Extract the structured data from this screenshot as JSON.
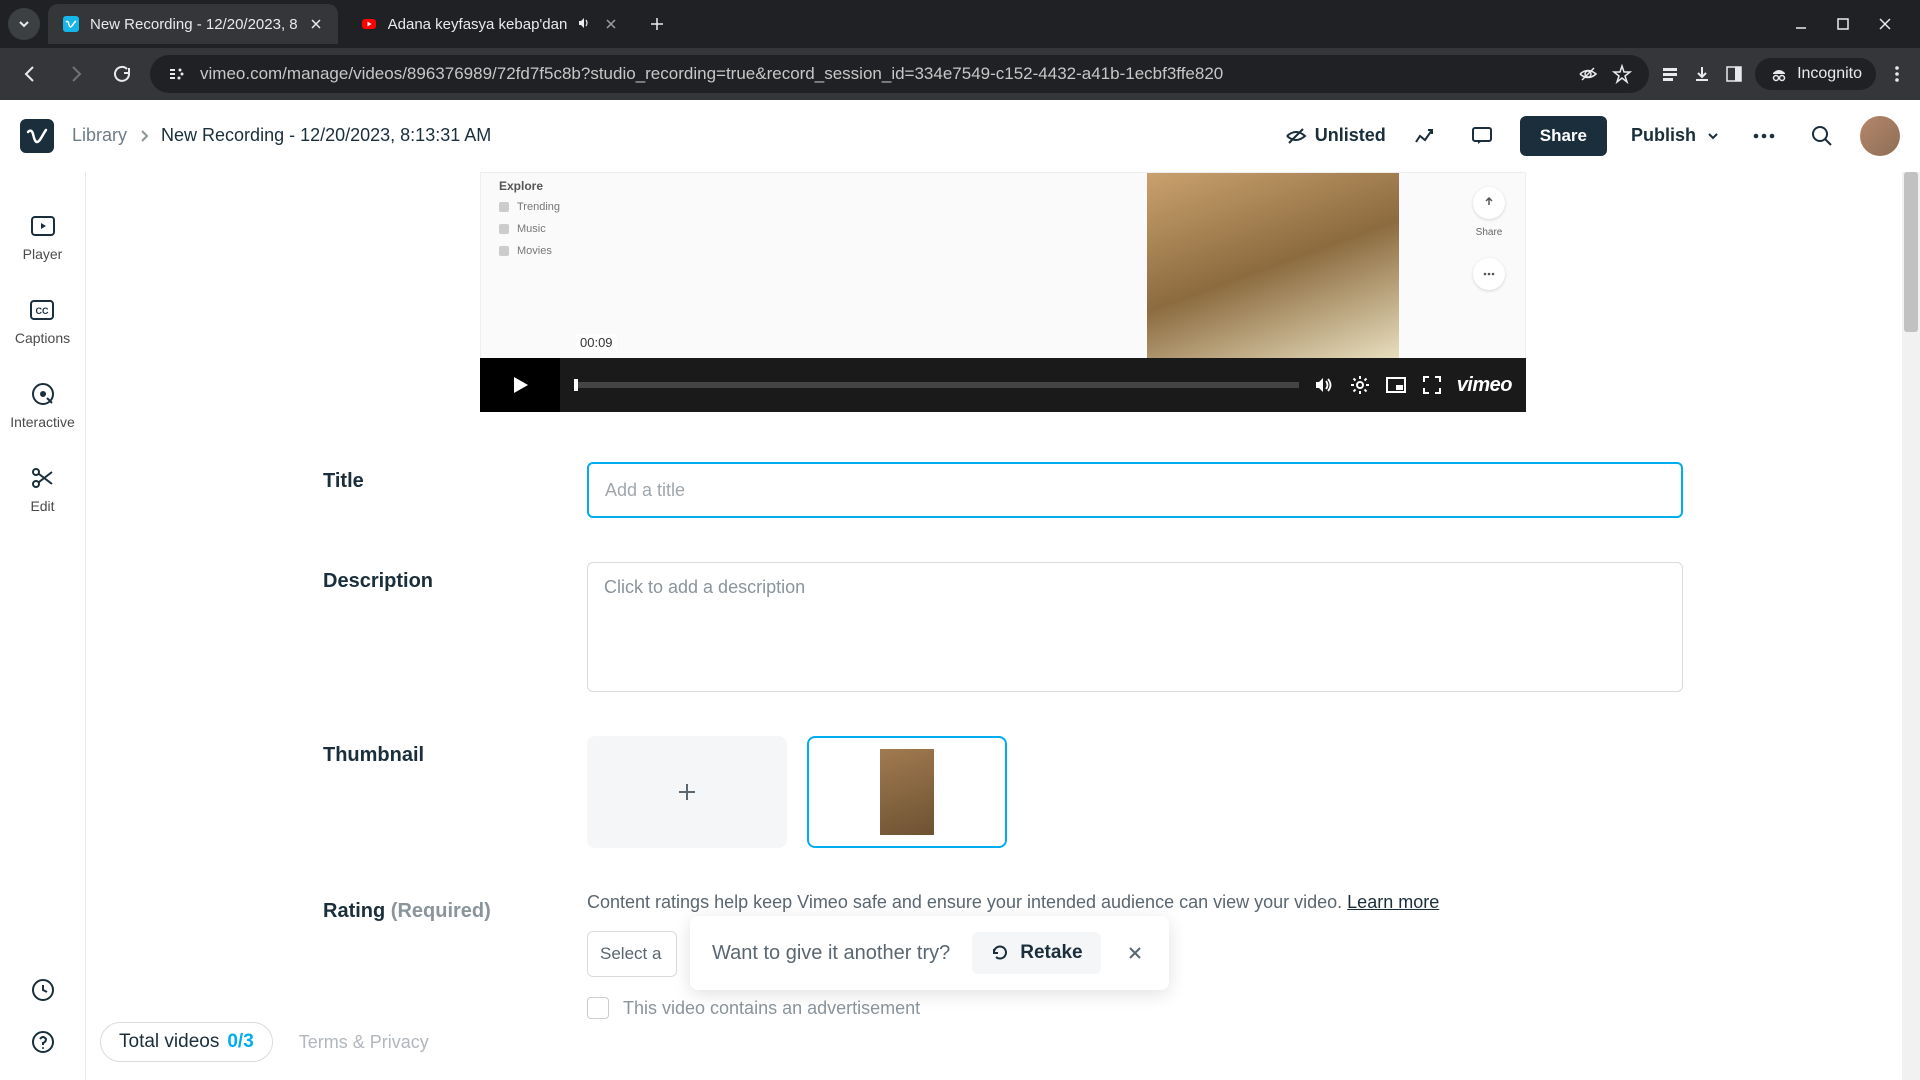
{
  "browser": {
    "tabs": [
      {
        "title": "New Recording - 12/20/2023, 8",
        "active": true,
        "favicon": "vimeo"
      },
      {
        "title": "Adana keyfasya kebap'dan",
        "active": false,
        "favicon": "youtube",
        "audio": true
      }
    ],
    "url": "vimeo.com/manage/videos/896376989/72fd7f5c8b?studio_recording=true&record_session_id=334e7549-c152-4432-a41b-1ecbf3ffe820",
    "incognito_label": "Incognito"
  },
  "header": {
    "breadcrumb_root": "Library",
    "breadcrumb_current": "New Recording - 12/20/2023, 8:13:31 AM",
    "privacy_label": "Unlisted",
    "share_label": "Share",
    "publish_label": "Publish"
  },
  "rail": {
    "items": [
      "Player",
      "Captions",
      "Interactive",
      "Edit"
    ]
  },
  "player": {
    "explore_head": "Explore",
    "explore_items": [
      "Trending",
      "Music",
      "Movies"
    ],
    "share_label": "Share",
    "timecode": "00:09",
    "brand": "vimeo"
  },
  "form": {
    "title_label": "Title",
    "title_placeholder": "Add a title",
    "title_value": "",
    "desc_label": "Description",
    "desc_placeholder": "Click to add a description",
    "thumb_label": "Thumbnail",
    "rating_label": "Rating",
    "rating_required": "(Required)",
    "rating_help_pre": "Content ratings help keep Vimeo safe and ensure your intended audience can view your video. ",
    "rating_learn_more": "Learn more",
    "rating_select_visible": "Select a",
    "ad_label": "This video contains an advertisement"
  },
  "toast": {
    "text": "Want to give it another try?",
    "retake_label": "Retake"
  },
  "bottom": {
    "total_label": "Total videos",
    "total_count": "0/3",
    "terms_label": "Terms & Privacy"
  }
}
